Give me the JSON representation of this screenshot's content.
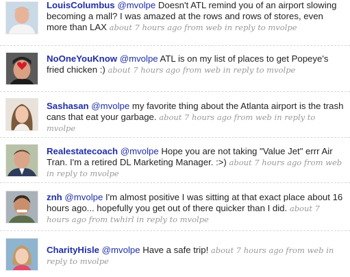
{
  "tweets": [
    {
      "user": "LouisColumbus",
      "mention": "@mvolpe",
      "text": " Doesn't ATL remind you of an airport slowing becoming a mall? I was amazed at the rows and rows of stores, even more than LAX",
      "time": "about 7 hours ago",
      "from": "from",
      "source": "web",
      "reply": "in reply to mvolpe",
      "avatar": "man-avatar"
    },
    {
      "user": "NoOneYouKnow",
      "mention": "@mvolpe",
      "text": " ATL is on my list of places to get Popeye's fried chicken :)",
      "time": "about 7 hours ago",
      "from": "from",
      "source": "web",
      "reply": "in reply to mvolpe",
      "avatar": "heart-glasses-avatar"
    },
    {
      "user": "Sashasan",
      "mention": "@mvolpe",
      "text": " my favorite thing about the Atlanta airport is the trash cans that eat your garbage.",
      "time": "about 7 hours ago",
      "from": "from",
      "source": "web",
      "reply": "in reply to mvolpe",
      "avatar": "woman-avatar"
    },
    {
      "user": "Realestatecoach",
      "mention": "@mvolpe",
      "text": " Hope you are not taking \"Value Jet\" errr Air Tran. I'm a retired DL Marketing Manager. :>)",
      "time": "about 7 hours ago",
      "from": "from",
      "source": "web",
      "reply": "in reply to mvolpe",
      "avatar": "man-avatar"
    },
    {
      "user": "znh",
      "mention": "@mvolpe",
      "text": " I'm almost positive I was sitting at that exact place about 16 hours ago... hopefully you get out of there quicker than I did.",
      "time": "about 7 hours ago",
      "from": "from",
      "source": "twhirl",
      "reply": "in reply to mvolpe",
      "avatar": "man-avatar"
    },
    {
      "user": "CharityHisle",
      "mention": "@mvolpe",
      "text": " Have a safe trip!",
      "time": "about 7 hours ago",
      "from": "from",
      "source": "web",
      "reply": "in reply to mvolpe",
      "avatar": "child-avatar"
    }
  ],
  "colors": {
    "link": "#1f2ea8",
    "meta": "#999999",
    "text": "#222222"
  }
}
